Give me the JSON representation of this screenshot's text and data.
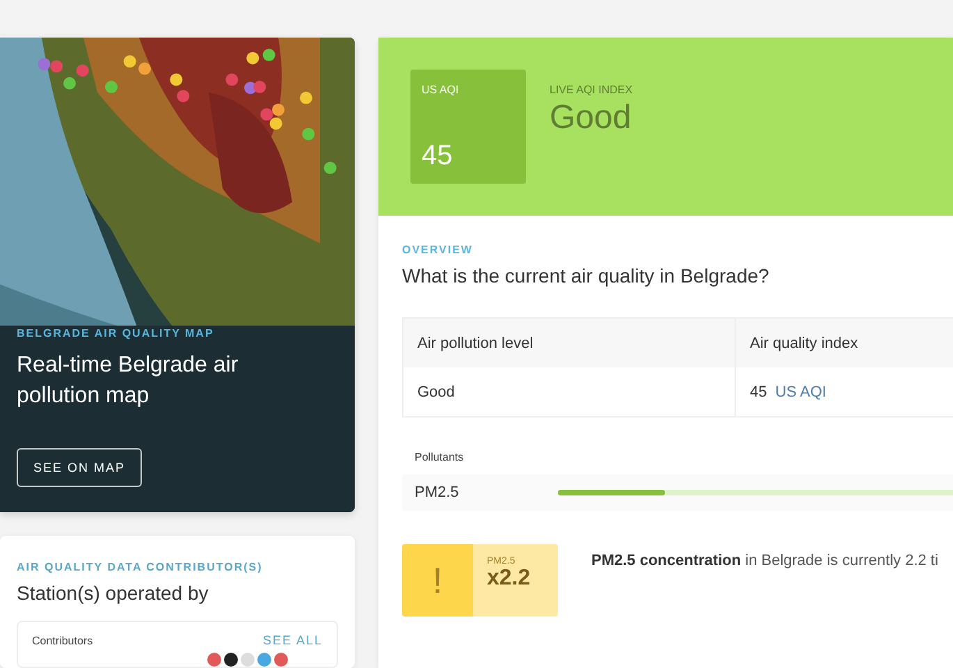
{
  "map_card": {
    "kind": "picture",
    "eyebrow": "BELGRADE AIR QUALITY MAP",
    "title": "Real-time Belgrade air pollution map",
    "button": "SEE ON MAP"
  },
  "contributors_card": {
    "eyebrow": "AIR QUALITY DATA CONTRIBUTOR(S)",
    "title": "Station(s) operated by",
    "box_label": "Contributors",
    "link": "SEE ALL",
    "logos": [
      {
        "color": "#e05a5a"
      },
      {
        "color": "#222222"
      },
      {
        "color": "#dddddd"
      },
      {
        "color": "#4aa8e0"
      },
      {
        "color": "#e05a5a"
      }
    ]
  },
  "aqi_header": {
    "badge_label": "US AQI",
    "badge_value": "45",
    "index_label": "LIVE AQI INDEX",
    "status": "Good"
  },
  "overview": {
    "eyebrow": "OVERVIEW",
    "question": "What is the current air quality in Belgrade?"
  },
  "table": {
    "columns": [
      "Air pollution level",
      "Air quality index"
    ],
    "rows": [
      {
        "level": "Good",
        "value": "45",
        "unit": "US AQI"
      }
    ]
  },
  "pollutants": {
    "label": "Pollutants",
    "items": [
      {
        "name": "PM2.5",
        "level": 0.27
      }
    ]
  },
  "warning": {
    "icon": "!",
    "pollutant": "PM2.5",
    "factor": "x2.2",
    "text": "**PM2.5 concentration** in Belgrade is currently 2.2 ti"
  }
}
